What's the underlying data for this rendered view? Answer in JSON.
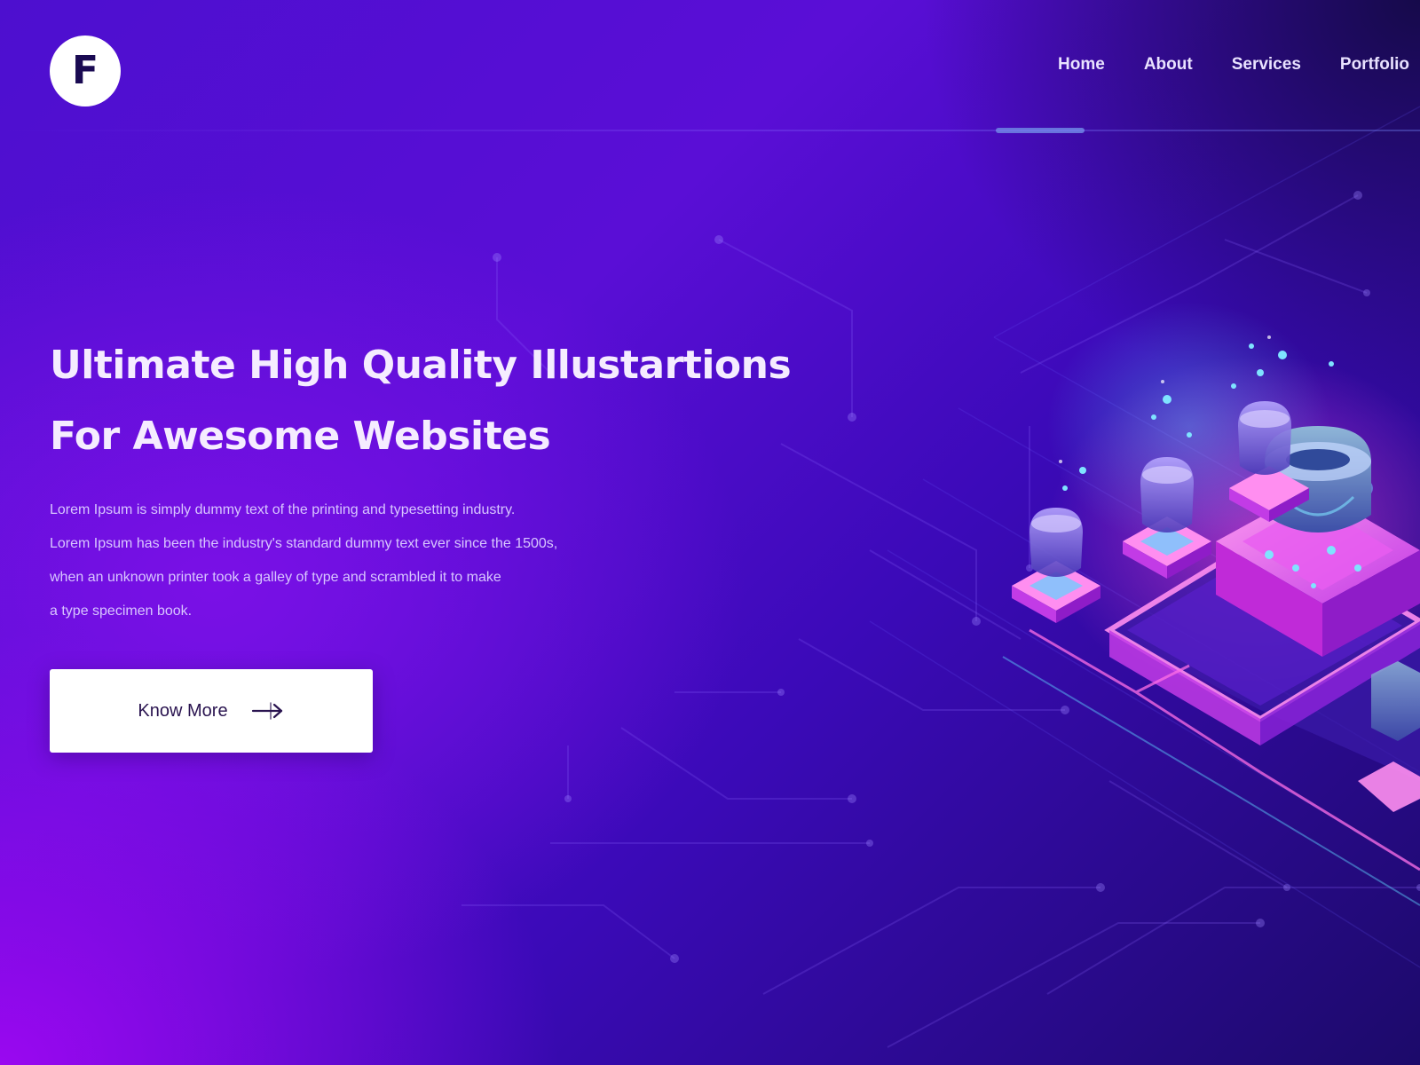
{
  "header": {
    "logo_letter": "F",
    "nav": [
      "Home",
      "About",
      "Services",
      "Portfolio"
    ]
  },
  "hero": {
    "title_line1": "Ultimate High Quality Illustartions",
    "title_line2": "For Awesome Websites",
    "description": [
      "Lorem Ipsum is simply dummy text of the printing and typesetting industry.",
      "Lorem Ipsum has been the industry's standard dummy text ever since the 1500s,",
      "when an unknown printer took a galley of type and scrambled it to make",
      "a type specimen book."
    ],
    "cta_label": "Know More"
  },
  "icons": {
    "logo": "f-logo-icon",
    "cta": "arrow-right-icon",
    "illustration": "isometric-servers-illustration"
  },
  "colors": {
    "background_start": "#9a08f0",
    "background_end": "#1c0a6a",
    "accent_underline": "#6b7fe0",
    "cta_background": "#ffffff",
    "cta_text": "#2a1450",
    "neon_pink": "#ff4fd8",
    "neon_cyan": "#5fd4ff"
  }
}
